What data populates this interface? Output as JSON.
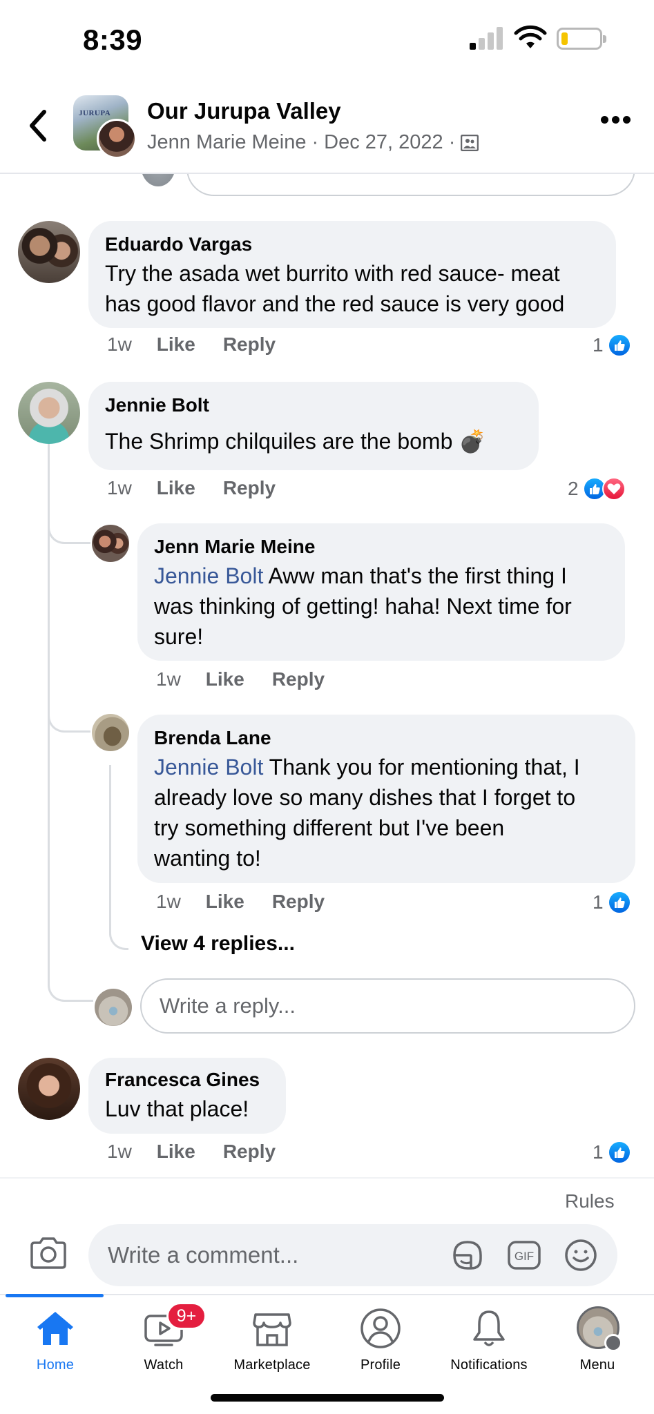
{
  "status_bar": {
    "time": "8:39"
  },
  "header": {
    "group_name": "Our Jurupa Valley",
    "group_avatar_text": "JURUPA",
    "author": "Jenn Marie Meine",
    "separator": "·",
    "date": "Dec 27, 2022"
  },
  "comments": [
    {
      "name": "Eduardo Vargas",
      "line1": "Try the asada wet burrito with red sauce- meat",
      "line2": "has good flavor and the red sauce is very good",
      "age": "1w",
      "like": "Like",
      "reply": "Reply",
      "reactions": "1"
    },
    {
      "name": "Jennie Bolt",
      "text": "The  Shrimp chilquiles are the bomb",
      "emoji": "💣",
      "age": "1w",
      "like": "Like",
      "reply": "Reply",
      "reactions": "2"
    },
    {
      "name": "Jenn Marie Meine",
      "mention": "Jennie Bolt",
      "line1": "Aww man that's the first thing I",
      "line2": "was thinking of getting! haha! Next time for",
      "line3": "sure!",
      "age": "1w",
      "like": "Like",
      "reply": "Reply"
    },
    {
      "name": "Brenda Lane",
      "mention": "Jennie Bolt",
      "line1": "Thank you for mentioning that, I",
      "line2": "already love so many dishes that I forget to",
      "line3": "try something different but I've been",
      "line4": "wanting to!",
      "age": "1w",
      "like": "Like",
      "reply": "Reply",
      "reactions": "1"
    },
    {
      "name": "Francesca Gines",
      "text": "Luv that place!",
      "age": "1w",
      "like": "Like",
      "reply": "Reply",
      "reactions": "1"
    }
  ],
  "view_replies": "View 4 replies...",
  "reply_placeholder": "Write a reply...",
  "rules": "Rules",
  "composer": {
    "placeholder": "Write a comment...",
    "gif_label": "GIF"
  },
  "tabs": [
    {
      "label": "Home"
    },
    {
      "label": "Watch",
      "badge": "9+"
    },
    {
      "label": "Marketplace"
    },
    {
      "label": "Profile"
    },
    {
      "label": "Notifications"
    },
    {
      "label": "Menu"
    }
  ],
  "colors": {
    "accent": "#1877f2",
    "mention": "#385898",
    "badge": "#e41e3f",
    "bubble": "#f0f2f5"
  },
  "icons": [
    "back-arrow-icon",
    "more-icon",
    "group-icon",
    "like-reaction-icon",
    "love-reaction-icon",
    "camera-icon",
    "sticker-icon",
    "gif-icon",
    "emoji-icon",
    "home-icon",
    "watch-icon",
    "marketplace-icon",
    "profile-icon",
    "bell-icon",
    "menu-avatar"
  ]
}
